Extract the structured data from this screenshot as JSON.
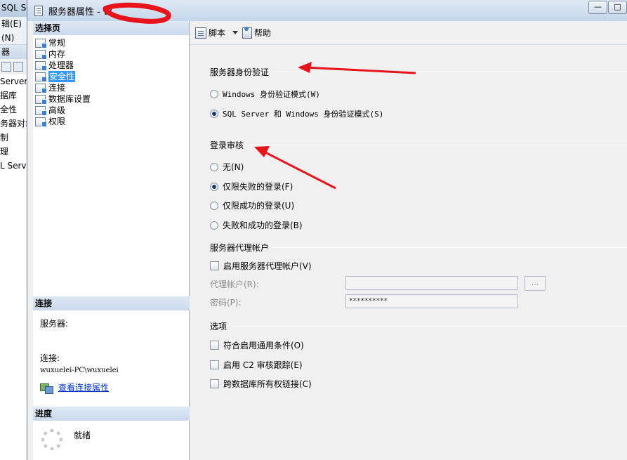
{
  "background_window": {
    "title": "SQL Se",
    "menu_top": "辑(E)",
    "menu_second": "(N)",
    "panel_header": "器",
    "tree_items": [
      "Server",
      "据库",
      "全性",
      "务器对象",
      "制",
      "理",
      "L Serve"
    ]
  },
  "dialog": {
    "title": "服务器属性 - W",
    "window_buttons": {
      "minimize": "—",
      "maximize": "□"
    },
    "colors": {
      "selection": "#3399ff",
      "link": "#0033cc",
      "annotation_arrow": "#e8141c"
    }
  },
  "left_pane": {
    "select_page_header": "选择页",
    "pages": [
      {
        "label": "常规",
        "selected": false
      },
      {
        "label": "内存",
        "selected": false
      },
      {
        "label": "处理器",
        "selected": false
      },
      {
        "label": "安全性",
        "selected": true
      },
      {
        "label": "连接",
        "selected": false
      },
      {
        "label": "数据库设置",
        "selected": false
      },
      {
        "label": "高级",
        "selected": false
      },
      {
        "label": "权限",
        "selected": false
      }
    ],
    "connection": {
      "header": "连接",
      "server_label": "服务器:",
      "server_value": "",
      "connection_label": "连接:",
      "connection_value": "wuxuelei-PC\\wuxuelei",
      "view_properties_link": "查看连接属性"
    },
    "progress": {
      "header": "进度",
      "status": "就绪"
    }
  },
  "toolbar": {
    "script_label": "脚本",
    "help_label": "帮助"
  },
  "server_auth": {
    "title": "服务器身份验证",
    "windows_mode": "Windows 身份验证模式(W)",
    "mixed_mode": "SQL Server 和 Windows 身份验证模式(S)",
    "selected": "mixed"
  },
  "login_audit": {
    "title": "登录审核",
    "none": "无(N)",
    "failed_only": "仅限失败的登录(F)",
    "success_only": "仅限成功的登录(U)",
    "both": "失败和成功的登录(B)",
    "selected": "failed_only"
  },
  "proxy": {
    "title": "服务器代理帐户",
    "enable_label": "启用服务器代理帐户(V)",
    "proxy_account_label": "代理帐户(R):",
    "proxy_account_value": "",
    "password_label": "密码(P):",
    "password_value": "**********",
    "browse_button": "..."
  },
  "options": {
    "title": "选项",
    "common_criteria": "符合启用通用条件(O)",
    "c2_audit": "启用 C2 审核跟踪(E)",
    "cross_db_chaining": "跨数据库所有权链接(C)"
  }
}
